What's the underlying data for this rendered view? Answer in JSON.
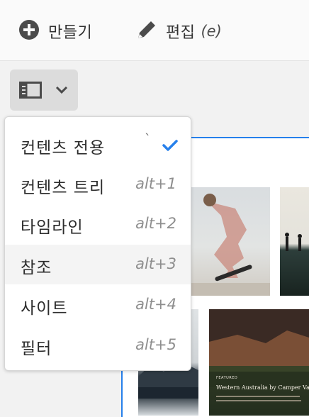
{
  "toolbar": {
    "create_label": "만들기",
    "edit_label": "편집",
    "edit_shortcut": "(e)"
  },
  "rail": {
    "toggle_icon": "panel-icon",
    "dropdown_icon": "chevron-down-icon"
  },
  "menu": {
    "items": [
      {
        "label": "컨텐츠 전용",
        "shortcut": "`",
        "selected": true
      },
      {
        "label": "컨텐츠 트리",
        "shortcut": "alt+1"
      },
      {
        "label": "타임라인",
        "shortcut": "alt+2"
      },
      {
        "label": "참조",
        "shortcut": "alt+3",
        "hovered": true
      },
      {
        "label": "사이트",
        "shortcut": "alt+4"
      },
      {
        "label": "필터",
        "shortcut": "alt+5"
      }
    ]
  },
  "canvas": {
    "featured_label": "FEATURED",
    "featured_title": "Western Australia by Camper Van"
  },
  "colors": {
    "accent": "#2680eb",
    "check": "#2680eb",
    "toggle_bg": "#dcdcdc"
  }
}
